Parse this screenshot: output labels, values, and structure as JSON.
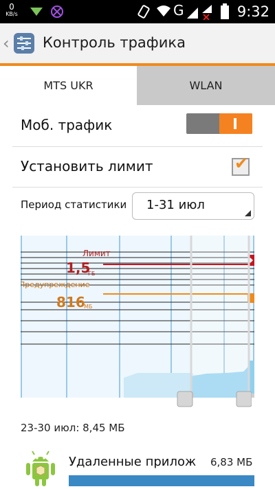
{
  "status_bar": {
    "speed_value": "0",
    "speed_unit": "KB/s",
    "time": "9:32",
    "network_letter": "G"
  },
  "action_bar": {
    "title": "Контроль трафика",
    "back_icon": "back-chevron-icon",
    "app_icon": "data-usage-settings-icon"
  },
  "tabs": [
    {
      "label": "MTS UKR",
      "selected": true
    },
    {
      "label": "WLAN",
      "selected": false
    }
  ],
  "settings": {
    "mobile_data_label": "Моб. трафик",
    "mobile_data_on": true,
    "set_limit_label": "Установить лимит",
    "set_limit_checked": true,
    "period_label": "Период статистики",
    "period_value": "1-31 июл"
  },
  "chart": {
    "limit_label": "Лимит",
    "limit_value": "1,5",
    "limit_unit": "ГБ",
    "warning_label": "Предупреждение",
    "warning_value": "816",
    "warning_unit": "МБ",
    "colors": {
      "limit": "#c8141e",
      "warning": "#f08a1c",
      "usage": "#8fd0ef",
      "grid": "#7fb8e2"
    }
  },
  "range_summary": "23-30 июл: 8,45 МБ",
  "app_list": [
    {
      "name": "Удаленные прилож",
      "size": "6,83 МБ",
      "icon": "android-robot-icon"
    }
  ]
}
